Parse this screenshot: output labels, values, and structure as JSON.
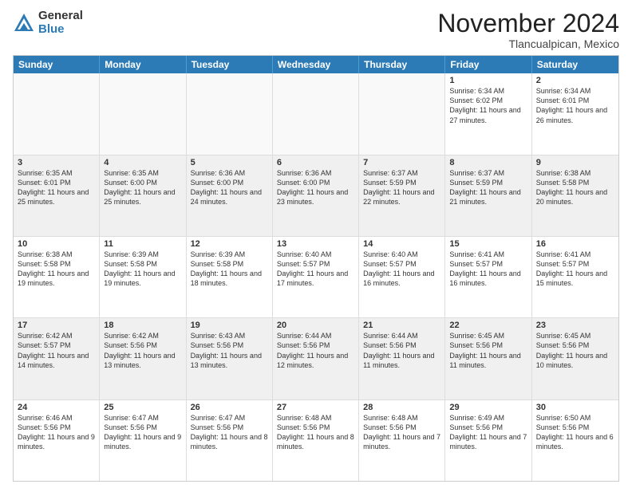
{
  "logo": {
    "general": "General",
    "blue": "Blue"
  },
  "title": "November 2024",
  "location": "Tlancualpican, Mexico",
  "days": [
    "Sunday",
    "Monday",
    "Tuesday",
    "Wednesday",
    "Thursday",
    "Friday",
    "Saturday"
  ],
  "weeks": [
    [
      {
        "day": "",
        "content": ""
      },
      {
        "day": "",
        "content": ""
      },
      {
        "day": "",
        "content": ""
      },
      {
        "day": "",
        "content": ""
      },
      {
        "day": "",
        "content": ""
      },
      {
        "day": "1",
        "content": "Sunrise: 6:34 AM\nSunset: 6:02 PM\nDaylight: 11 hours and 27 minutes."
      },
      {
        "day": "2",
        "content": "Sunrise: 6:34 AM\nSunset: 6:01 PM\nDaylight: 11 hours and 26 minutes."
      }
    ],
    [
      {
        "day": "3",
        "content": "Sunrise: 6:35 AM\nSunset: 6:01 PM\nDaylight: 11 hours and 25 minutes."
      },
      {
        "day": "4",
        "content": "Sunrise: 6:35 AM\nSunset: 6:00 PM\nDaylight: 11 hours and 25 minutes."
      },
      {
        "day": "5",
        "content": "Sunrise: 6:36 AM\nSunset: 6:00 PM\nDaylight: 11 hours and 24 minutes."
      },
      {
        "day": "6",
        "content": "Sunrise: 6:36 AM\nSunset: 6:00 PM\nDaylight: 11 hours and 23 minutes."
      },
      {
        "day": "7",
        "content": "Sunrise: 6:37 AM\nSunset: 5:59 PM\nDaylight: 11 hours and 22 minutes."
      },
      {
        "day": "8",
        "content": "Sunrise: 6:37 AM\nSunset: 5:59 PM\nDaylight: 11 hours and 21 minutes."
      },
      {
        "day": "9",
        "content": "Sunrise: 6:38 AM\nSunset: 5:58 PM\nDaylight: 11 hours and 20 minutes."
      }
    ],
    [
      {
        "day": "10",
        "content": "Sunrise: 6:38 AM\nSunset: 5:58 PM\nDaylight: 11 hours and 19 minutes."
      },
      {
        "day": "11",
        "content": "Sunrise: 6:39 AM\nSunset: 5:58 PM\nDaylight: 11 hours and 19 minutes."
      },
      {
        "day": "12",
        "content": "Sunrise: 6:39 AM\nSunset: 5:58 PM\nDaylight: 11 hours and 18 minutes."
      },
      {
        "day": "13",
        "content": "Sunrise: 6:40 AM\nSunset: 5:57 PM\nDaylight: 11 hours and 17 minutes."
      },
      {
        "day": "14",
        "content": "Sunrise: 6:40 AM\nSunset: 5:57 PM\nDaylight: 11 hours and 16 minutes."
      },
      {
        "day": "15",
        "content": "Sunrise: 6:41 AM\nSunset: 5:57 PM\nDaylight: 11 hours and 16 minutes."
      },
      {
        "day": "16",
        "content": "Sunrise: 6:41 AM\nSunset: 5:57 PM\nDaylight: 11 hours and 15 minutes."
      }
    ],
    [
      {
        "day": "17",
        "content": "Sunrise: 6:42 AM\nSunset: 5:57 PM\nDaylight: 11 hours and 14 minutes."
      },
      {
        "day": "18",
        "content": "Sunrise: 6:42 AM\nSunset: 5:56 PM\nDaylight: 11 hours and 13 minutes."
      },
      {
        "day": "19",
        "content": "Sunrise: 6:43 AM\nSunset: 5:56 PM\nDaylight: 11 hours and 13 minutes."
      },
      {
        "day": "20",
        "content": "Sunrise: 6:44 AM\nSunset: 5:56 PM\nDaylight: 11 hours and 12 minutes."
      },
      {
        "day": "21",
        "content": "Sunrise: 6:44 AM\nSunset: 5:56 PM\nDaylight: 11 hours and 11 minutes."
      },
      {
        "day": "22",
        "content": "Sunrise: 6:45 AM\nSunset: 5:56 PM\nDaylight: 11 hours and 11 minutes."
      },
      {
        "day": "23",
        "content": "Sunrise: 6:45 AM\nSunset: 5:56 PM\nDaylight: 11 hours and 10 minutes."
      }
    ],
    [
      {
        "day": "24",
        "content": "Sunrise: 6:46 AM\nSunset: 5:56 PM\nDaylight: 11 hours and 9 minutes."
      },
      {
        "day": "25",
        "content": "Sunrise: 6:47 AM\nSunset: 5:56 PM\nDaylight: 11 hours and 9 minutes."
      },
      {
        "day": "26",
        "content": "Sunrise: 6:47 AM\nSunset: 5:56 PM\nDaylight: 11 hours and 8 minutes."
      },
      {
        "day": "27",
        "content": "Sunrise: 6:48 AM\nSunset: 5:56 PM\nDaylight: 11 hours and 8 minutes."
      },
      {
        "day": "28",
        "content": "Sunrise: 6:48 AM\nSunset: 5:56 PM\nDaylight: 11 hours and 7 minutes."
      },
      {
        "day": "29",
        "content": "Sunrise: 6:49 AM\nSunset: 5:56 PM\nDaylight: 11 hours and 7 minutes."
      },
      {
        "day": "30",
        "content": "Sunrise: 6:50 AM\nSunset: 5:56 PM\nDaylight: 11 hours and 6 minutes."
      }
    ]
  ]
}
